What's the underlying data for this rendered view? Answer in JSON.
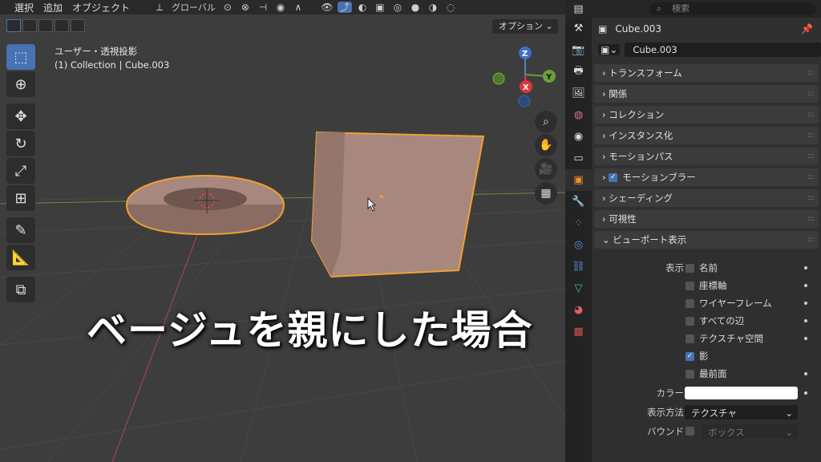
{
  "header": {
    "menus": [
      "選択",
      "追加",
      "オブジェクト"
    ],
    "transform_orientation": "グローバル"
  },
  "viewport": {
    "options_label": "オプション",
    "view_name": "ユーザー・透視投影",
    "collection_line": "(1) Collection | Cube.003",
    "caption": "ベージュを親にした場合",
    "gizmo_axes": [
      "Z",
      "Y",
      "X"
    ]
  },
  "properties": {
    "search_placeholder": "検索",
    "object_name": "Cube.003",
    "object_field": "Cube.003",
    "panels": [
      "トランスフォーム",
      "関係",
      "コレクション",
      "インスタンス化",
      "モーションパス",
      "モーションブラー",
      "シェーディング",
      "可視性"
    ],
    "viewport_display": {
      "title": "ビューポート表示",
      "show_label": "表示",
      "options": [
        {
          "label": "名前",
          "checked": false
        },
        {
          "label": "座標軸",
          "checked": false
        },
        {
          "label": "ワイヤーフレーム",
          "checked": false
        },
        {
          "label": "すべての辺",
          "checked": false
        },
        {
          "label": "テクスチャ空間",
          "checked": false
        },
        {
          "label": "影",
          "checked": true
        },
        {
          "label": "最前面",
          "checked": false
        }
      ],
      "color_label": "カラー",
      "color_value": "#ffffff",
      "display_as_label": "表示方法",
      "display_as_value": "テクスチャ",
      "bounds_label": "バウンド",
      "bounds_value": "ボックス"
    }
  },
  "colors": {
    "accent": "#4772b3",
    "selection_outline": "#f0a030",
    "object": "#a8887e"
  }
}
